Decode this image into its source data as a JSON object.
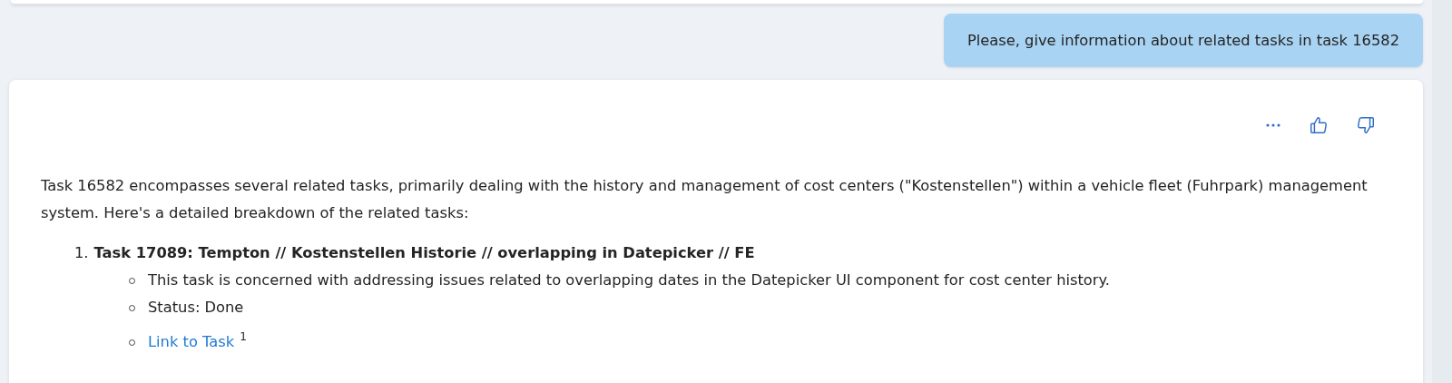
{
  "user_message": {
    "text": "Please, give information about related tasks in task 16582"
  },
  "response": {
    "intro": "Task 16582 encompasses several related tasks, primarily dealing with the history and management of cost centers (\"Kostenstellen\") within a vehicle fleet (Fuhrpark) management system. Here's a detailed breakdown of the related tasks:",
    "tasks": [
      {
        "number": "1.",
        "title": "Task 17089: Tempton // Kostenstellen Historie // overlapping in Datepicker // FE",
        "details": [
          {
            "kind": "text",
            "text": "This task is concerned with addressing issues related to overlapping dates in the Datepicker UI component for cost center history."
          },
          {
            "kind": "text",
            "text": "Status: Done"
          },
          {
            "kind": "link",
            "text": "Link to Task",
            "citation": "1"
          }
        ]
      }
    ]
  }
}
